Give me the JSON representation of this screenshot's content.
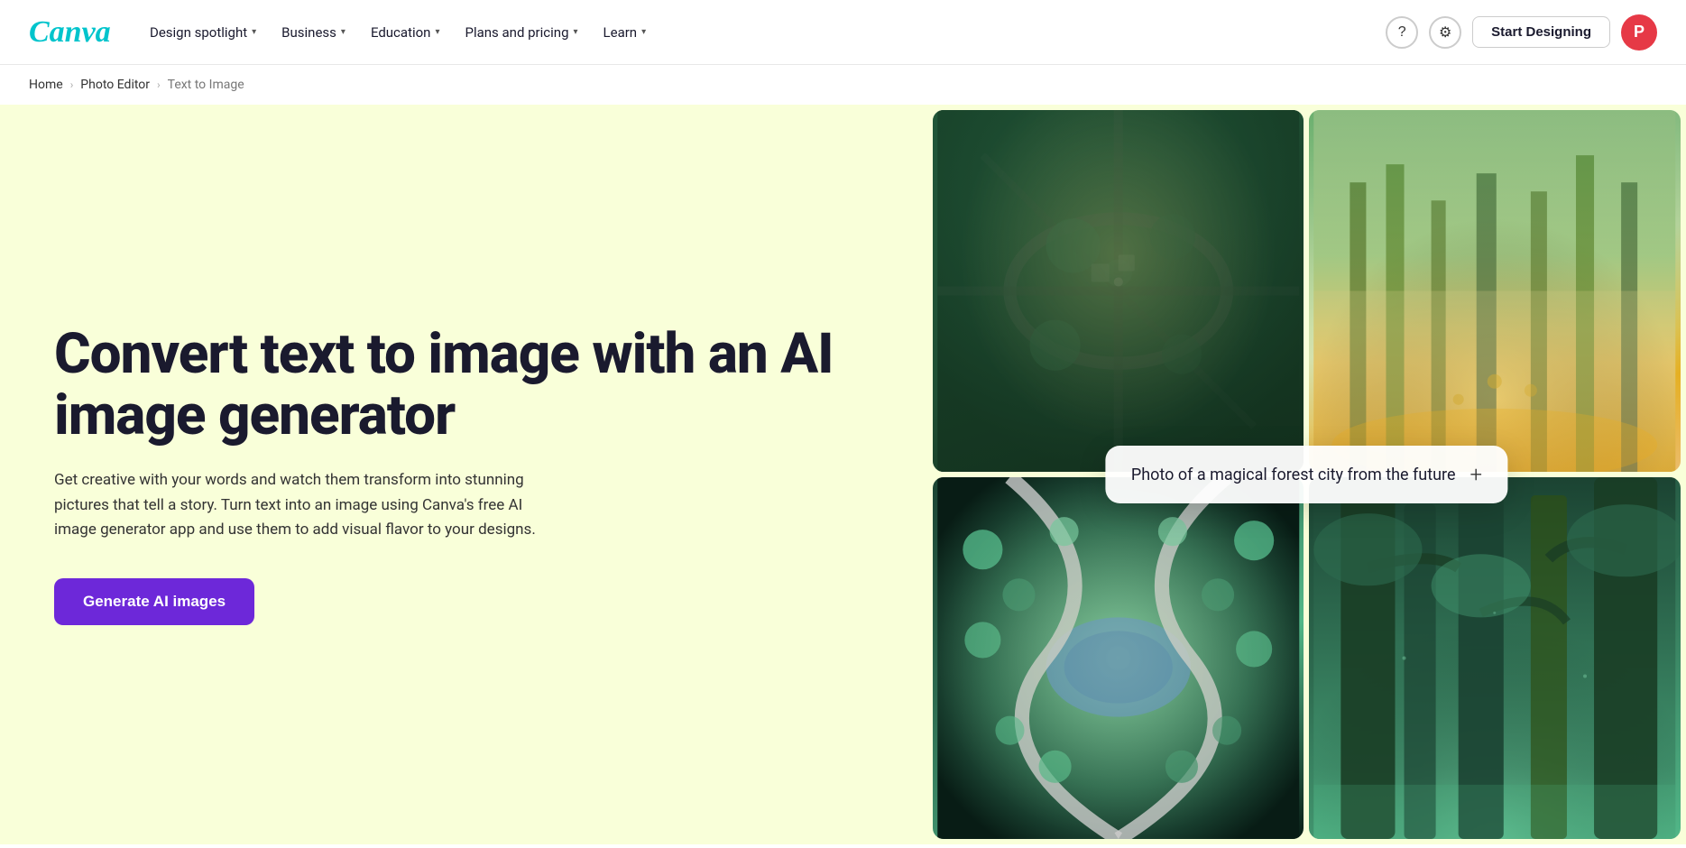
{
  "nav": {
    "logo_text": "Canva",
    "links": [
      {
        "id": "design-spotlight",
        "label": "Design spotlight",
        "has_chevron": true
      },
      {
        "id": "business",
        "label": "Business",
        "has_chevron": true
      },
      {
        "id": "education",
        "label": "Education",
        "has_chevron": true
      },
      {
        "id": "plans-pricing",
        "label": "Plans and pricing",
        "has_chevron": true
      },
      {
        "id": "learn",
        "label": "Learn",
        "has_chevron": true
      }
    ],
    "start_designing_label": "Start Designing",
    "avatar_initial": "P"
  },
  "breadcrumb": {
    "items": [
      {
        "id": "home",
        "label": "Home"
      },
      {
        "id": "photo-editor",
        "label": "Photo Editor"
      },
      {
        "id": "text-to-image",
        "label": "Text to Image",
        "current": true
      }
    ]
  },
  "hero": {
    "title": "Convert text to image with an AI image generator",
    "subtitle": "Get creative with your words and watch them transform into stunning pictures that tell a story. Turn text into an image using Canva's free AI image generator app and use them to add visual flavor to your designs.",
    "cta_label": "Generate AI images"
  },
  "prompt": {
    "text": "Photo of a magical forest city from the future",
    "plus_icon": "+"
  },
  "images": [
    {
      "id": "img-1",
      "alt": "Aerial view of futuristic green city"
    },
    {
      "id": "img-2",
      "alt": "Misty magical forest with golden light"
    },
    {
      "id": "img-3",
      "alt": "Aerial view of winding roads through forest"
    },
    {
      "id": "img-4",
      "alt": "Tall ancient trees in a mystical forest"
    }
  ]
}
